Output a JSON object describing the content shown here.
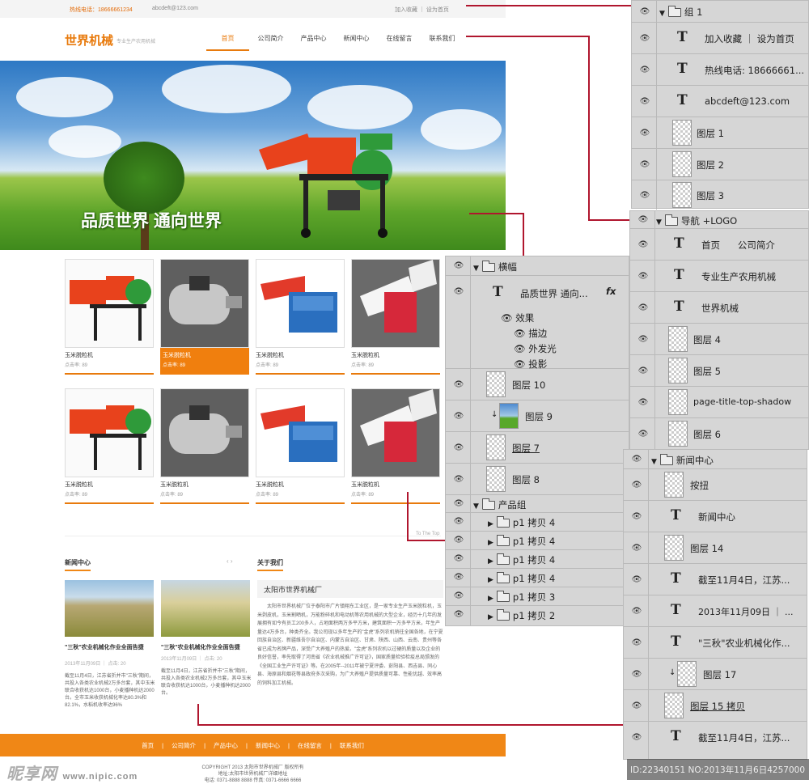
{
  "site": {
    "topbar": {
      "hotline": "热线电话：18666661234",
      "email": "abcdeft@123.com",
      "links": "加入收藏 ｜ 设为首页"
    },
    "logo": "世界机械",
    "slogan": "专业生产农用机械",
    "nav": [
      "首页",
      "公司简介",
      "产品中心",
      "新闻中心",
      "在线留言",
      "联系我们"
    ],
    "banner_text": "品质世界 通向世界",
    "products": [
      {
        "name": "玉米脱粒机",
        "clicks": "点击率: 89"
      },
      {
        "name": "玉米脱粒机",
        "clicks": "点击率: 89"
      },
      {
        "name": "玉米脱粒机",
        "clicks": "点击率: 89"
      },
      {
        "name": "玉米脱粒机",
        "clicks": "点击率: 89"
      },
      {
        "name": "玉米脱粒机",
        "clicks": "点击率: 89"
      },
      {
        "name": "玉米脱粒机",
        "clicks": "点击率: 89"
      },
      {
        "name": "玉米脱粒机",
        "clicks": "点击率: 89"
      },
      {
        "name": "玉米脱粒机",
        "clicks": "点击率: 89"
      }
    ],
    "to_top": "To The Top",
    "news_title": "新闻中心",
    "news": [
      {
        "title": "\"三秋\"农业机械化作业全面告捷",
        "date": "2013年11月09日 ｜ 点击: 20",
        "body": "截至11月4日，江苏省折并市\"三秋\"期间，共投入各类农业机械2万多台套，其中玉米联合收获机达1000台，小麦播种机达2000台。全市玉米收获机械化率达80.3%和82.1%，水稻机收率达96%"
      },
      {
        "title": "\"三秋\"农业机械化作业全面告捷",
        "date": "2013年11月09日 ｜ 点击: 20",
        "body": "截至11月4日，江苏省折并市\"三秋\"期间，共投入各类农业机械2万多台套，其中玉米联合收获机达1000台，小麦播种机达2000台。"
      }
    ],
    "about_title": "关于我们",
    "about_company": "太阳市世界机械厂",
    "about_body": "太阳市世界机械厂位于泰阳市广片镇翔东工业区，是一家专业生产玉米脱粒机，玉米剥皮机，玉米割晒机，万能粉碎机和电动机等农用机械的大型企业，经历十几年的发展拥有如今有员工200多人，占地面积两万多平方米，建筑面积一万多平方米，年生产量达4万多台，种类齐全。我公司现以多年生产的\"金虎\"系列农机销往全国各地，在宁夏回族自治区、新疆维吾尔自治区、内蒙古自治区、甘肃、陕西、山西、云南、贵州等各省已成为名牌产品，深受广大养殖户的热爱。\"金虎\"系列农机以过硬的质量以及企业的良好信誉，率先取得了河南省《农业机械推广许可证》，国家质量检验检疫总局颁发的《全国工业生产许可证》等。在2005年--2011年被宁夏评委、彭阳县、西吉县、同心县、海原县和烟花等县政府多次采购，为广大养殖户提供质量可靠、性能优越、效率高的饲料加工机械。",
    "footer_nav": [
      "首页",
      "公司简介",
      "产品中心",
      "新闻中心",
      "在线留言",
      "联系我们"
    ],
    "copyright": "COPYRIGHT 2013 太阳市世界机械厂 版权所有",
    "address": "地址:太阳市世界机械厂详细地址",
    "phone": "电话: 0371-8888 8888   传真: 0371-6666 6666"
  },
  "panel1": {
    "group": "组 1",
    "rows": [
      {
        "type": "text",
        "label": "加入收藏 ｜ 设为首页"
      },
      {
        "type": "text",
        "label": "热线电话: 18666661..."
      },
      {
        "type": "text",
        "label": "abcdeft@123.com"
      },
      {
        "type": "layer",
        "label": "图层 1"
      },
      {
        "type": "layer",
        "label": "图层 2"
      },
      {
        "type": "layer",
        "label": "图层 3"
      }
    ]
  },
  "panel2": {
    "group": "导航 +LOGO",
    "rows": [
      {
        "type": "text",
        "label": "首页      公司简介"
      },
      {
        "type": "text",
        "label": "专业生产农用机械"
      },
      {
        "type": "text",
        "label": "世界机械"
      },
      {
        "type": "layer",
        "label": "图层 4"
      },
      {
        "type": "layer",
        "label": "图层 5"
      },
      {
        "type": "layer",
        "label": "page-title-top-shadow"
      },
      {
        "type": "layer",
        "label": "图层 6"
      }
    ]
  },
  "panel3": {
    "group": "横幅",
    "text_layer": "品质世界 通向...",
    "fx": "fx",
    "effects_label": "效果",
    "effects": [
      "描边",
      "外发光",
      "投影"
    ],
    "layers": [
      "图层 10",
      "图层 9",
      "图层 7",
      "图层 8"
    ],
    "product_group": "产品组",
    "copies": [
      "p1 拷贝 4",
      "p1 拷贝 4",
      "p1 拷贝 4",
      "p1 拷贝 4",
      "p1 拷贝 3",
      "p1 拷贝 2"
    ]
  },
  "panel4": {
    "group": "新闻中心",
    "rows": [
      {
        "type": "layer",
        "label": "按扭"
      },
      {
        "type": "text",
        "label": "新闻中心"
      },
      {
        "type": "layer",
        "label": "图层 14"
      },
      {
        "type": "text",
        "label": "截至11月4日，江苏..."
      },
      {
        "type": "text",
        "label": "2013年11月09日 ｜ ..."
      },
      {
        "type": "text",
        "label": "\"三秋\"农业机械化作..."
      },
      {
        "type": "layer",
        "label": "图层 17"
      },
      {
        "type": "layer",
        "label": "图层 15 拷贝"
      },
      {
        "type": "text",
        "label": "截至11月4日，江苏..."
      }
    ]
  },
  "watermark": {
    "brand": "昵享网",
    "url": "www.nipic.com"
  },
  "id_bar": "ID:22340151 NO:2013年11月6日4257000",
  "colors": {
    "accent": "#f08716",
    "panel_bg": "#d6d6d6",
    "connector": "#b0162e"
  }
}
